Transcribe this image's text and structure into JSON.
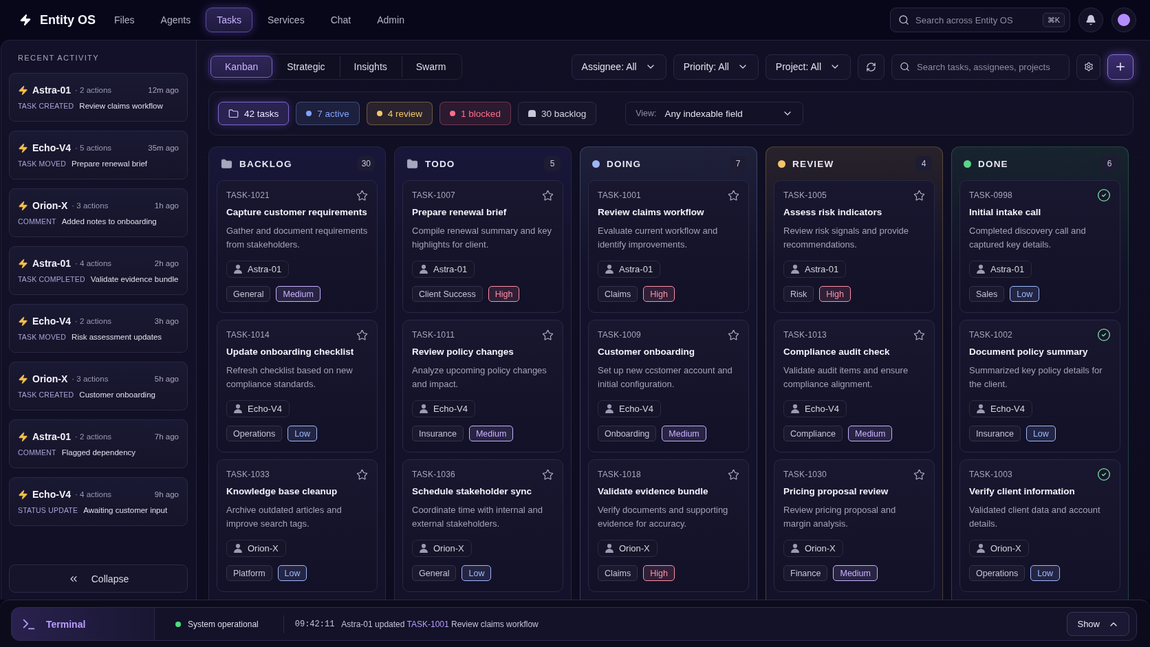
{
  "app": {
    "name": "Entity OS"
  },
  "nav": [
    {
      "label": "Files",
      "selected": false
    },
    {
      "label": "Agents",
      "selected": false
    },
    {
      "label": "Tasks",
      "selected": true
    },
    {
      "label": "Services",
      "selected": false
    },
    {
      "label": "Chat",
      "selected": false
    },
    {
      "label": "Admin",
      "selected": false
    }
  ],
  "global_search": {
    "placeholder": "Search across Entity OS",
    "shortcut": "⌘K"
  },
  "sidebar": {
    "title": "RECENT ACTIVITY",
    "items": [
      {
        "agent": "Astra-01",
        "actions": "· 2 actions",
        "time": "12m ago",
        "event": "TASK CREATED",
        "summary": "Review claims workflow"
      },
      {
        "agent": "Echo-V4",
        "actions": "· 5 actions",
        "time": "35m ago",
        "event": "TASK MOVED",
        "summary": "Prepare renewal brief"
      },
      {
        "agent": "Orion-X",
        "actions": "· 3 actions",
        "time": "1h ago",
        "event": "COMMENT",
        "summary": "Added notes to onboarding"
      },
      {
        "agent": "Astra-01",
        "actions": "· 4 actions",
        "time": "2h ago",
        "event": "TASK COMPLETED",
        "summary": "Validate evidence bundle"
      },
      {
        "agent": "Echo-V4",
        "actions": "· 2 actions",
        "time": "3h ago",
        "event": "TASK MOVED",
        "summary": "Risk assessment updates"
      },
      {
        "agent": "Orion-X",
        "actions": "· 3 actions",
        "time": "5h ago",
        "event": "TASK CREATED",
        "summary": "Customer onboarding"
      },
      {
        "agent": "Astra-01",
        "actions": "· 2 actions",
        "time": "7h ago",
        "event": "COMMENT",
        "summary": "Flagged dependency"
      },
      {
        "agent": "Echo-V4",
        "actions": "· 4 actions",
        "time": "9h ago",
        "event": "STATUS UPDATE",
        "summary": "Awaiting customer input"
      }
    ],
    "collapse_button": "Collapse"
  },
  "view_tabs": [
    {
      "label": "Kanban",
      "selected": true
    },
    {
      "label": "Strategic",
      "selected": false
    },
    {
      "label": "Insights",
      "selected": false
    },
    {
      "label": "Swarm",
      "selected": false
    }
  ],
  "filters": [
    "Assignee: All",
    "Priority: All",
    "Project: All"
  ],
  "task_search": {
    "placeholder": "Search tasks, assignees, projects"
  },
  "summary_chips": [
    {
      "kind": "total",
      "label": "42 tasks",
      "selected": true
    },
    {
      "kind": "status",
      "label": "7 active",
      "color": "#7fa4ff",
      "selected": false
    },
    {
      "kind": "status",
      "label": "4 review",
      "color": "#f2c76b",
      "selected": false
    },
    {
      "kind": "status",
      "label": "1 blocked",
      "color": "#ff6f86",
      "selected": false
    },
    {
      "kind": "backlog",
      "label": "30 backlog",
      "selected": false
    }
  ],
  "view_select": {
    "label": "View:",
    "value": "Any indexable field"
  },
  "columns": [
    {
      "title": "BACKLOG",
      "count": "30",
      "kind": "folder",
      "cards": [
        {
          "id": "TASK-1021",
          "title": "Capture customer requirements",
          "description": "Gather and document requirements from stakeholders.",
          "assignee": "Astra-01",
          "project": "General",
          "priority": {
            "label": "Medium",
            "color": "#c9b0ff"
          },
          "completed": false
        },
        {
          "id": "TASK-1014",
          "title": "Update onboarding checklist",
          "description": "Refresh checklist based on new compliance standards.",
          "assignee": "Echo-V4",
          "project": "Operations",
          "priority": {
            "label": "Low",
            "color": "#9fb9ff"
          },
          "completed": false
        },
        {
          "id": "TASK-1033",
          "title": "Knowledge base cleanup",
          "description": "Archive outdated articles and improve search tags.",
          "assignee": "Orion-X",
          "project": "Platform",
          "priority": {
            "label": "Low",
            "color": "#9fb9ff"
          },
          "completed": false
        }
      ]
    },
    {
      "title": "TODO",
      "count": "5",
      "kind": "folder",
      "cards": [
        {
          "id": "TASK-1007",
          "title": "Prepare renewal brief",
          "description": "Compile renewal summary and key highlights for client.",
          "assignee": "Astra-01",
          "project": "Client Success",
          "priority": {
            "label": "High",
            "color": "#ff8fa3"
          },
          "completed": false
        },
        {
          "id": "TASK-1011",
          "title": "Review policy changes",
          "description": "Analyze upcoming policy changes and impact.",
          "assignee": "Echo-V4",
          "project": "Insurance",
          "priority": {
            "label": "Medium",
            "color": "#c9b0ff"
          },
          "completed": false
        },
        {
          "id": "TASK-1036",
          "title": "Schedule stakeholder sync",
          "description": "Coordinate time with internal and external stakeholders.",
          "assignee": "Orion-X",
          "project": "General",
          "priority": {
            "label": "Low",
            "color": "#9fb9ff"
          },
          "completed": false
        }
      ]
    },
    {
      "title": "DOING",
      "count": "7",
      "kind": "dot",
      "color": "#9db4f5",
      "cards": [
        {
          "id": "TASK-1001",
          "title": "Review claims workflow",
          "description": "Evaluate current workflow and identify improvements.",
          "assignee": "Astra-01",
          "project": "Claims",
          "priority": {
            "label": "High",
            "color": "#ff8fa3"
          },
          "completed": false
        },
        {
          "id": "TASK-1009",
          "title": "Customer onboarding",
          "description": "Set up new ccstomer account and initial configuration.",
          "assignee": "Echo-V4",
          "project": "Onboarding",
          "priority": {
            "label": "Medium",
            "color": "#c9b0ff"
          },
          "completed": false
        },
        {
          "id": "TASK-1018",
          "title": "Validate evidence bundle",
          "description": "Verify documents and supporting evidence for accuracy.",
          "assignee": "Orion-X",
          "project": "Claims",
          "priority": {
            "label": "High",
            "color": "#ff8fa3"
          },
          "completed": false
        }
      ]
    },
    {
      "title": "REVIEW",
      "count": "4",
      "kind": "dot",
      "color": "#f4c46a",
      "cards": [
        {
          "id": "TASK-1005",
          "title": "Assess risk indicators",
          "description": "Review risk signals and provide recommendations.",
          "assignee": "Astra-01",
          "project": "Risk",
          "priority": {
            "label": "High",
            "color": "#ff8fa3"
          },
          "completed": false
        },
        {
          "id": "TASK-1013",
          "title": "Compliance audit check",
          "description": "Validate audit items and ensure compliance alignment.",
          "assignee": "Echo-V4",
          "project": "Compliance",
          "priority": {
            "label": "Medium",
            "color": "#c9b0ff"
          },
          "completed": false
        },
        {
          "id": "TASK-1030",
          "title": "Pricing proposal review",
          "description": "Review pricing proposal and margin analysis.",
          "assignee": "Orion-X",
          "project": "Finance",
          "priority": {
            "label": "Medium",
            "color": "#c9b0ff"
          },
          "completed": false
        }
      ]
    },
    {
      "title": "DONE",
      "count": "6",
      "kind": "dot",
      "color": "#5ad58a",
      "cards": [
        {
          "id": "TASK-0998",
          "title": "Initial intake call",
          "description": "Completed discovery call and captured key details.",
          "assignee": "Astra-01",
          "project": "Sales",
          "priority": {
            "label": "Low",
            "color": "#9fb9ff"
          },
          "completed": true
        },
        {
          "id": "TASK-1002",
          "title": "Document policy summary",
          "description": "Summarized key policy details for the client.",
          "assignee": "Echo-V4",
          "project": "Insurance",
          "priority": {
            "label": "Low",
            "color": "#9fb9ff"
          },
          "completed": true
        },
        {
          "id": "TASK-1003",
          "title": "Verify client information",
          "description": "Validated client data and account details.",
          "assignee": "Orion-X",
          "project": "Operations",
          "priority": {
            "label": "Low",
            "color": "#9fb9ff"
          },
          "completed": true
        }
      ]
    }
  ],
  "terminal": {
    "label": "Terminal",
    "status": {
      "text": "System operational",
      "ok": true
    },
    "log": {
      "time": "09:42:11",
      "before": "Astra-01 updated",
      "link": "TASK-1001",
      "after": "Review claims workflow"
    },
    "toggle": "Show"
  }
}
